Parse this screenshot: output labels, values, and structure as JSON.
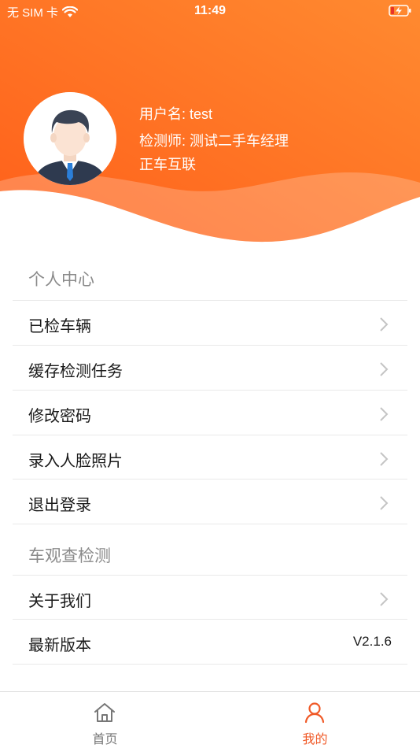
{
  "status_bar": {
    "carrier": "无 SIM 卡",
    "time": "11:49"
  },
  "profile": {
    "username_line": "用户名: test",
    "inspector_line": "检测师: 测试二手车经理",
    "company": "正车互联"
  },
  "sections": {
    "personal": {
      "title": "个人中心",
      "items": [
        {
          "label": "已检车辆"
        },
        {
          "label": "缓存检测任务"
        },
        {
          "label": "修改密码"
        },
        {
          "label": "录入人脸照片"
        },
        {
          "label": "退出登录"
        }
      ]
    },
    "about": {
      "title": "车观查检测",
      "items": [
        {
          "label": "关于我们"
        },
        {
          "label": "最新版本",
          "value": "V2.1.6"
        }
      ]
    }
  },
  "tabbar": {
    "home_label": "首页",
    "me_label": "我的",
    "active": "me"
  },
  "colors": {
    "accent": "#f05a28",
    "header_start": "#ff6a1e",
    "header_end": "#ff8a3a"
  }
}
